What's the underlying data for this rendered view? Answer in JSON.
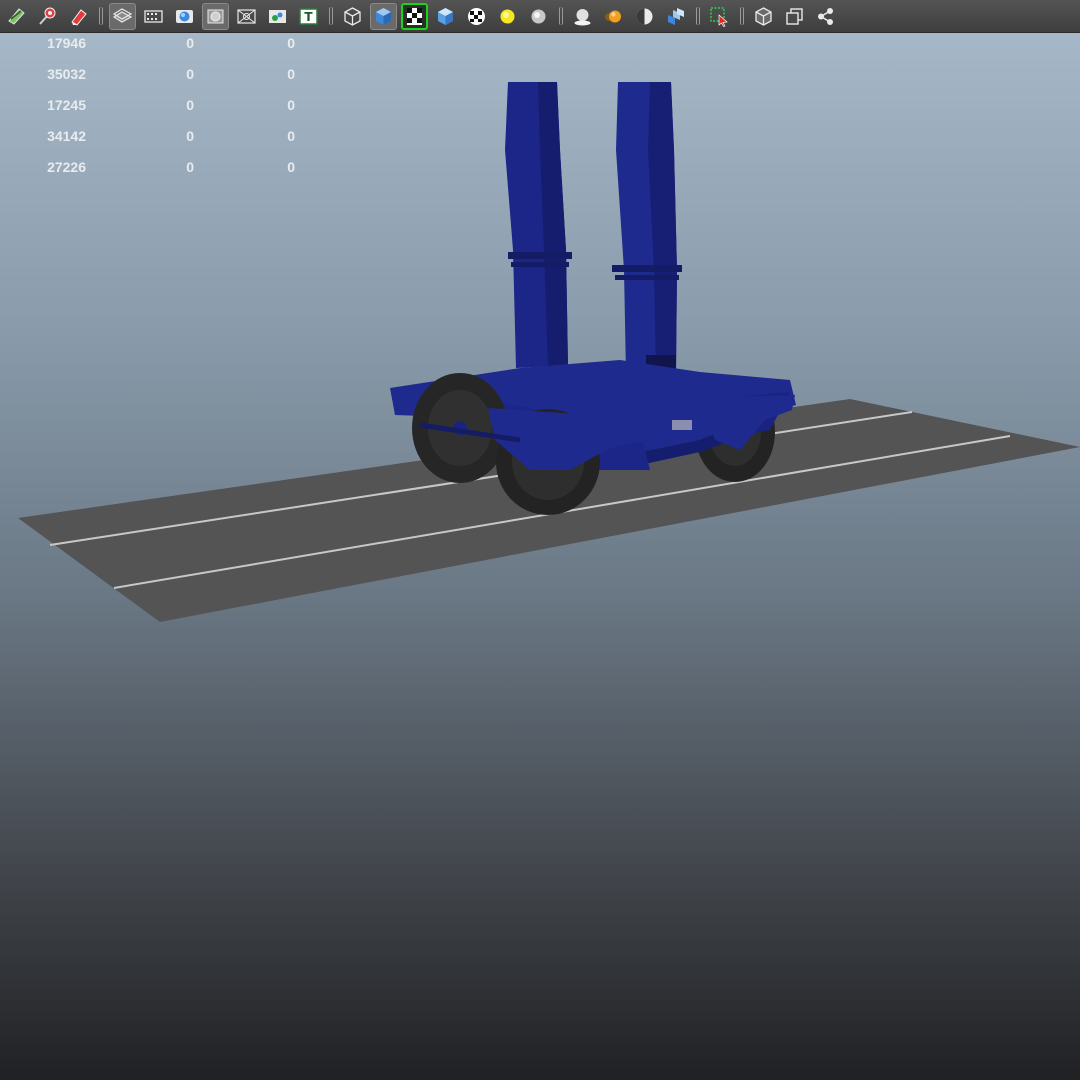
{
  "toolbar": {
    "groups": [
      [
        "select-camera-icon",
        "camera-attributes-icon",
        "bookmark-icon"
      ],
      [
        "image-plane-icon",
        "film-gate-icon",
        "resolution-gate-icon",
        "gate-mask-icon",
        "field-chart-icon",
        "safe-action-icon",
        "safe-title-icon"
      ],
      [
        "wireframe-icon",
        "smooth-shade-icon",
        "wireframe-on-shaded-icon",
        "default-material-icon",
        "textured-icon",
        "use-all-lights-icon",
        "shadows-icon"
      ],
      [
        "screen-space-ao-icon",
        "motion-blur-icon",
        "multisample-aa-icon",
        "depth-of-field-icon"
      ],
      [
        "isolate-select-icon"
      ],
      [
        "xray-icon",
        "xray-joints-icon",
        "xray-active-components-icon"
      ]
    ],
    "active_button": "wireframe-on-shaded-icon"
  },
  "hud": {
    "rows": [
      [
        "17946",
        "0",
        "0"
      ],
      [
        "35032",
        "0",
        "0"
      ],
      [
        "17245",
        "0",
        "0"
      ],
      [
        "34142",
        "0",
        "0"
      ],
      [
        "27226",
        "0",
        "0"
      ]
    ]
  },
  "scene": {
    "background_top": "#a9bbcb",
    "background_bottom": "#202124",
    "ground_color": "#545454",
    "rail_color": "#c8c8c8",
    "model_color": "#1f2a8a",
    "wheel_color": "#2a2a2a"
  }
}
